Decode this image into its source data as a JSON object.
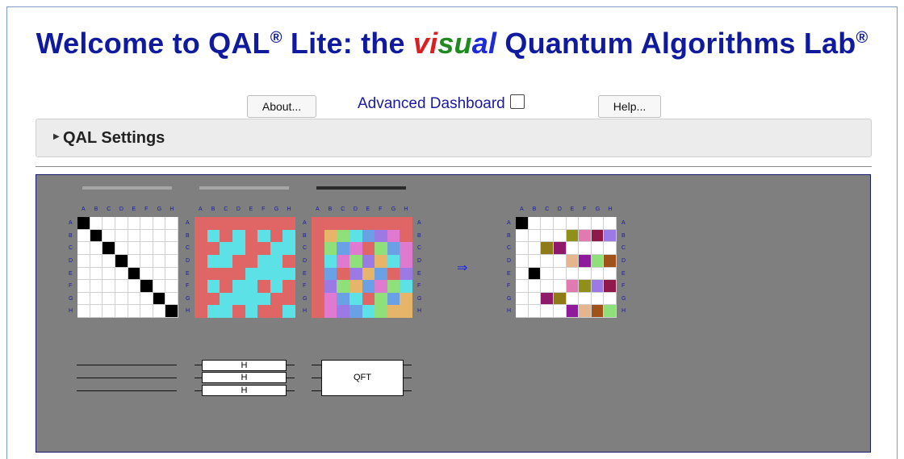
{
  "header": {
    "title_prefix": "Welcome to QAL",
    "title_mid": " Lite: the ",
    "vis_v": "vi",
    "vis_s": "su",
    "vis_al": "al",
    "title_suffix": " Quantum Algorithms Lab",
    "reg": "®"
  },
  "controls": {
    "about_label": "About...",
    "advanced_label": "Advanced Dashboard",
    "advanced_checked": false,
    "help_label": "Help..."
  },
  "settings": {
    "label": "QAL Settings",
    "expanded": false
  },
  "matrix_labels": {
    "columns": [
      "A",
      "B",
      "C",
      "D",
      "E",
      "F",
      "G",
      "H"
    ],
    "rows": [
      "A",
      "B",
      "C",
      "D",
      "E",
      "F",
      "G",
      "H"
    ]
  },
  "arrow_symbol": "⇒",
  "circuits": {
    "hadamard_gates": [
      "H",
      "H",
      "H"
    ],
    "qft_label": "QFT"
  },
  "colors": {
    "title": "#0f1a9e",
    "panel_bg": "#7f7f7f",
    "matrix_red": "#e06666",
    "matrix_cyan": "#5ce1e6"
  },
  "matrices": {
    "identity": [
      [
        1,
        0,
        0,
        0,
        0,
        0,
        0,
        0
      ],
      [
        0,
        1,
        0,
        0,
        0,
        0,
        0,
        0
      ],
      [
        0,
        0,
        1,
        0,
        0,
        0,
        0,
        0
      ],
      [
        0,
        0,
        0,
        1,
        0,
        0,
        0,
        0
      ],
      [
        0,
        0,
        0,
        0,
        1,
        0,
        0,
        0
      ],
      [
        0,
        0,
        0,
        0,
        0,
        1,
        0,
        0
      ],
      [
        0,
        0,
        0,
        0,
        0,
        0,
        1,
        0
      ],
      [
        0,
        0,
        0,
        0,
        0,
        0,
        0,
        1
      ]
    ],
    "hadamard": [
      [
        "r",
        "r",
        "r",
        "r",
        "r",
        "r",
        "r",
        "r"
      ],
      [
        "r",
        "c",
        "r",
        "c",
        "r",
        "c",
        "r",
        "c"
      ],
      [
        "r",
        "r",
        "c",
        "c",
        "r",
        "r",
        "c",
        "c"
      ],
      [
        "r",
        "c",
        "c",
        "r",
        "r",
        "c",
        "c",
        "r"
      ],
      [
        "r",
        "r",
        "r",
        "r",
        "c",
        "c",
        "c",
        "c"
      ],
      [
        "r",
        "c",
        "r",
        "c",
        "c",
        "r",
        "c",
        "r"
      ],
      [
        "r",
        "r",
        "c",
        "c",
        "c",
        "c",
        "r",
        "r"
      ],
      [
        "r",
        "c",
        "c",
        "r",
        "c",
        "r",
        "r",
        "c"
      ]
    ],
    "qft": [
      [
        "#e06666",
        "#e06666",
        "#e06666",
        "#e06666",
        "#e06666",
        "#e06666",
        "#e06666",
        "#e06666"
      ],
      [
        "#e06666",
        "#e6b56a",
        "#8fe07a",
        "#5ce1e6",
        "#6aa0e6",
        "#9b7ae6",
        "#e07ad0",
        "#e06666"
      ],
      [
        "#e06666",
        "#8fe07a",
        "#6aa0e6",
        "#e07ad0",
        "#e06666",
        "#8fe07a",
        "#6aa0e6",
        "#e07ad0"
      ],
      [
        "#e06666",
        "#5ce1e6",
        "#e07ad0",
        "#8fe07a",
        "#9b7ae6",
        "#e6b56a",
        "#5ce1e6",
        "#e07ad0"
      ],
      [
        "#e06666",
        "#6aa0e6",
        "#e06666",
        "#9b7ae6",
        "#e6b56a",
        "#6aa0e6",
        "#e06666",
        "#9b7ae6"
      ],
      [
        "#e06666",
        "#9b7ae6",
        "#8fe07a",
        "#e6b56a",
        "#6aa0e6",
        "#e07ad0",
        "#8fe07a",
        "#5ce1e6"
      ],
      [
        "#e06666",
        "#e07ad0",
        "#6aa0e6",
        "#5ce1e6",
        "#e06666",
        "#8fe07a",
        "#6aa0e6",
        "#e6b56a"
      ],
      [
        "#e06666",
        "#e07ad0",
        "#9b7ae6",
        "#6aa0e6",
        "#5ce1e6",
        "#8fe07a",
        "#e6b56a",
        "#e6b56a"
      ]
    ],
    "result": [
      [
        "#000",
        "#fff",
        "#fff",
        "#fff",
        "#fff",
        "#fff",
        "#fff",
        "#fff"
      ],
      [
        "#fff",
        "#fff",
        "#fff",
        "#fff",
        "#8f8f1a",
        "#e07ab0",
        "#8f1a4a",
        "#9b7ae6"
      ],
      [
        "#fff",
        "#fff",
        "#8f7a1a",
        "#8f1a6a",
        "#fff",
        "#fff",
        "#fff",
        "#fff"
      ],
      [
        "#fff",
        "#fff",
        "#fff",
        "#fff",
        "#e6b58f",
        "#8f1a9b",
        "#8fe07a",
        "#a0521a"
      ],
      [
        "#fff",
        "#000",
        "#fff",
        "#fff",
        "#fff",
        "#fff",
        "#fff",
        "#fff"
      ],
      [
        "#fff",
        "#fff",
        "#fff",
        "#fff",
        "#e07ab0",
        "#8f8f1a",
        "#9b7ae6",
        "#8f1a4a"
      ],
      [
        "#fff",
        "#fff",
        "#8f1a6a",
        "#8f7a1a",
        "#fff",
        "#fff",
        "#fff",
        "#fff"
      ],
      [
        "#fff",
        "#fff",
        "#fff",
        "#fff",
        "#8f1a9b",
        "#e6b58f",
        "#a0521a",
        "#8fe07a"
      ]
    ]
  }
}
